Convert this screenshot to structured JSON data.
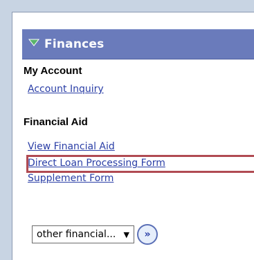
{
  "panel": {
    "title": "Finances",
    "sections": [
      {
        "title": "My Account",
        "links": [
          "Account Inquiry"
        ]
      },
      {
        "title": "Financial Aid",
        "links": [
          "View Financial Aid",
          "Direct Loan Processing Form",
          "Supplement Form"
        ]
      }
    ],
    "select": {
      "selected": "other financial..."
    },
    "go_button_label": "»"
  },
  "colors": {
    "page_bg": "#c8d4e3",
    "header_bg": "#6a7bbb",
    "link": "#2a3ea6",
    "highlight": "#b04a52"
  }
}
